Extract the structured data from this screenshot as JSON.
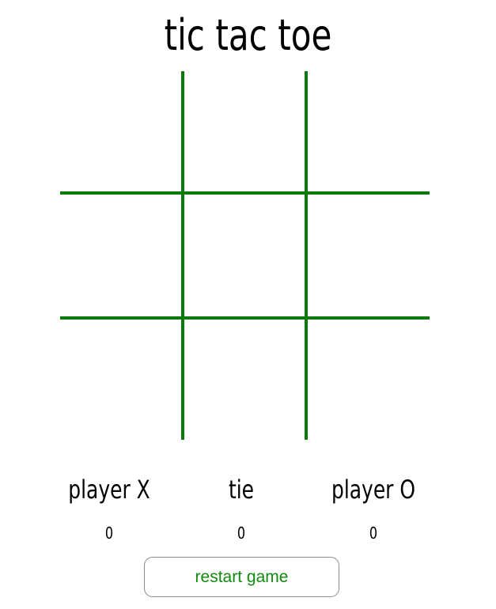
{
  "title": "tic tac toe",
  "colors": {
    "grid_line": "#0b7a0b",
    "button_text": "#0e8a0e",
    "button_border": "#8a8a8a",
    "background": "#ffffff"
  },
  "board": {
    "rows": 3,
    "cols": 3,
    "cells": [
      "",
      "",
      "",
      "",
      "",
      "",
      "",
      "",
      ""
    ]
  },
  "scores": [
    {
      "label": "player X",
      "value": "0"
    },
    {
      "label": "tie",
      "value": "0"
    },
    {
      "label": "player O",
      "value": "0"
    }
  ],
  "restart_label": "restart game"
}
